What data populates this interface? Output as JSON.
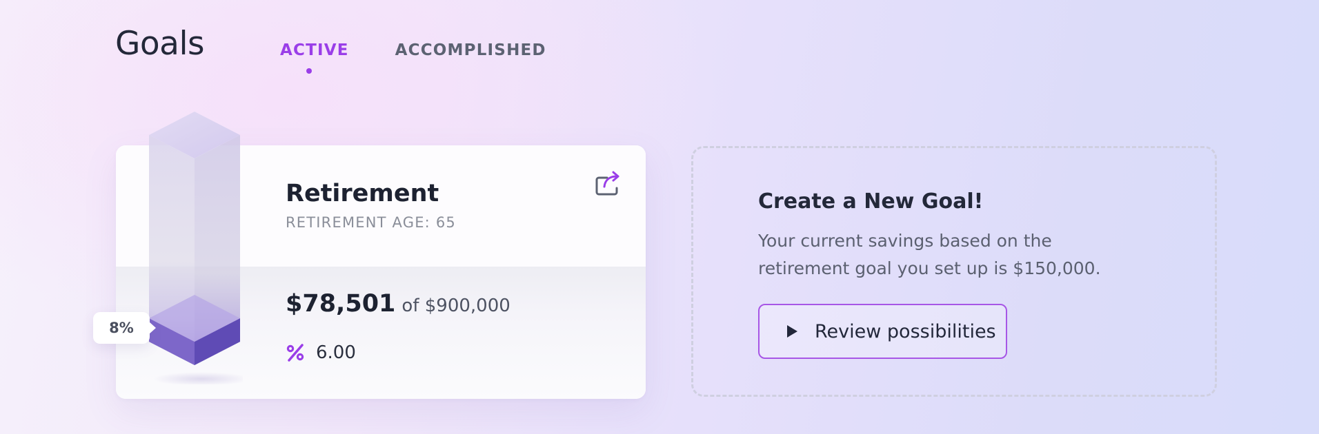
{
  "header": {
    "title": "Goals",
    "tabs": [
      {
        "label": "ACTIVE",
        "active": true
      },
      {
        "label": "ACCOMPLISHED",
        "active": false
      }
    ]
  },
  "goal_card": {
    "title": "Retirement",
    "subtitle": "RETIREMENT AGE: 65",
    "current_amount": "$78,501",
    "target_amount": "of $900,000",
    "rate_value": "6.00",
    "rate_icon": "percent-icon",
    "share_icon": "share-icon",
    "progress_label": "8%",
    "progress_fraction": 0.08
  },
  "new_goal": {
    "title": "Create a New Goal!",
    "description": "Your current savings based on the retirement goal you set up is $150,000.",
    "button_label": "Review possibilities",
    "button_icon": "play-icon"
  },
  "colors": {
    "accent": "#9a3ee8",
    "bar_fill": "#7a63c8",
    "text_dark": "#1d2231"
  }
}
